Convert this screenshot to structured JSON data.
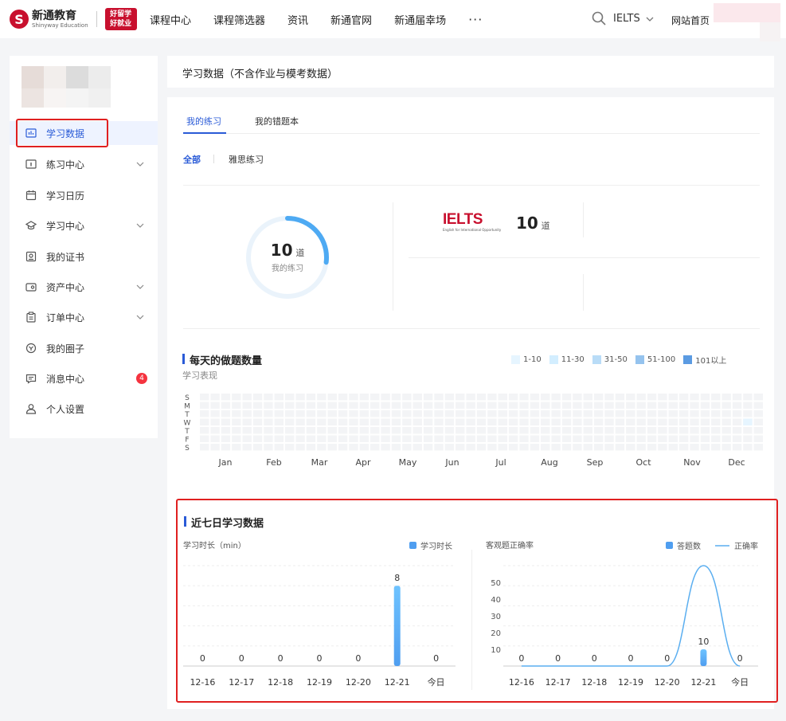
{
  "brand": {
    "name": "新通教育",
    "sub": "Shinyway Education",
    "badge_line1": "好留学",
    "badge_line2": "好就业"
  },
  "nav": {
    "items": [
      "课程中心",
      "课程筛选器",
      "资讯",
      "新通官网",
      "新通届幸场"
    ],
    "more": "···",
    "exam": "IELTS",
    "home": "网站首页"
  },
  "sidebar": {
    "items": [
      {
        "label": "学习数据",
        "icon": "chart-icon",
        "chevron": false
      },
      {
        "label": "练习中心",
        "icon": "exercise-icon",
        "chevron": true
      },
      {
        "label": "学习日历",
        "icon": "calendar-icon",
        "chevron": false
      },
      {
        "label": "学习中心",
        "icon": "graduation-cap-icon",
        "chevron": true
      },
      {
        "label": "我的证书",
        "icon": "certificate-icon",
        "chevron": false
      },
      {
        "label": "资产中心",
        "icon": "wallet-icon",
        "chevron": true
      },
      {
        "label": "订单中心",
        "icon": "clipboard-icon",
        "chevron": true
      },
      {
        "label": "我的圈子",
        "icon": "circle-icon",
        "chevron": false
      },
      {
        "label": "消息中心",
        "icon": "message-icon",
        "chevron": false,
        "badge": "4"
      },
      {
        "label": "个人设置",
        "icon": "user-icon",
        "chevron": false
      }
    ]
  },
  "header": {
    "title": "学习数据（不含作业与模考数据）"
  },
  "tabs": [
    "我的练习",
    "我的错题本"
  ],
  "subtabs": [
    "全部",
    "雅思练习"
  ],
  "summary": {
    "total": "10",
    "unit": "道",
    "label": "我的练习",
    "ielts_word": "IELTS",
    "ielts_tag": "English for International Opportunity",
    "ielts_count": "10",
    "progress": 0.27
  },
  "heatmap": {
    "title": "每天的做题数量",
    "subtitle": "学习表现",
    "weekdays": [
      "S",
      "M",
      "T",
      "W",
      "T",
      "F",
      "S"
    ],
    "months": [
      "Jan",
      "Feb",
      "Mar",
      "Apr",
      "May",
      "Jun",
      "Jul",
      "Aug",
      "Sep",
      "Oct",
      "Nov",
      "Dec"
    ],
    "legend": [
      {
        "label": "1-10",
        "color": "#e6f5ff"
      },
      {
        "label": "11-30",
        "color": "#d3eeff"
      },
      {
        "label": "31-50",
        "color": "#b9dcf7"
      },
      {
        "label": "51-100",
        "color": "#95c3ee"
      },
      {
        "label": "101以上",
        "color": "#5b9be2"
      }
    ],
    "empty_color": "#f3f4f6"
  },
  "seven_days": {
    "title": "近七日学习数据",
    "colors": {
      "bar": "#4f9ef0",
      "bar_top": "#6ec3ff",
      "line": "#5aaef0"
    }
  },
  "chart_data": [
    {
      "type": "bar",
      "ylabel": "学习时长（min）",
      "series": [
        {
          "name": "学习时长",
          "values": [
            0,
            0,
            0,
            0,
            0,
            8,
            0
          ]
        }
      ],
      "categories": [
        "12-16",
        "12-17",
        "12-18",
        "12-19",
        "12-20",
        "12-21",
        "今日"
      ],
      "grid": true,
      "legend": "top-right"
    },
    {
      "type": "bar",
      "ylabel": "客观题正确率",
      "categories": [
        "12-16",
        "12-17",
        "12-18",
        "12-19",
        "12-20",
        "12-21",
        "今日"
      ],
      "series": [
        {
          "name": "答题数",
          "type": "bar",
          "values": [
            0,
            0,
            0,
            0,
            0,
            10,
            0
          ]
        },
        {
          "name": "正确率",
          "type": "line",
          "values": [
            0,
            0,
            0,
            0,
            0,
            60,
            0
          ]
        }
      ],
      "yticks": [
        10,
        20,
        30,
        40,
        50
      ],
      "ylim": [
        0,
        60
      ],
      "grid": true,
      "legend": "top-right"
    }
  ]
}
